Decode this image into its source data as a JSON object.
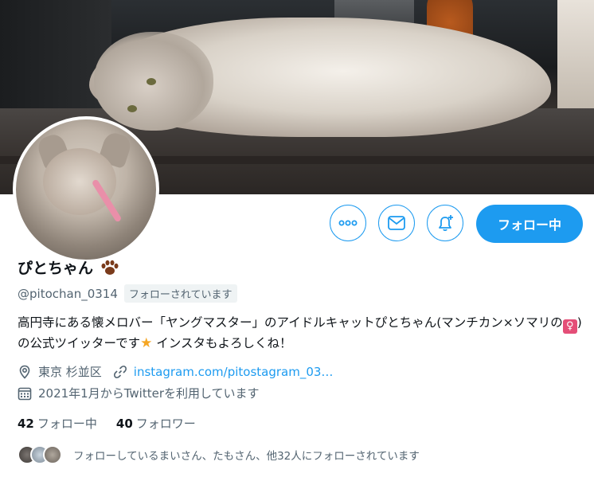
{
  "profile": {
    "name": "ぴとちゃん",
    "handle": "@pitochan_0314",
    "follows_you_badge": "フォローされています",
    "bio_part1": "高円寺にある懐メロバー「ヤングマスター」のアイドルキャットぴとちゃん(マンチカン×ソマリの",
    "bio_emoji_female": "♀",
    "bio_part2": ")の公式ツイッターです",
    "bio_emoji_star": "★",
    "bio_part3": " インスタもよろしくね！",
    "location": "東京 杉並区",
    "website": "instagram.com/pitostagram_03…",
    "joined": "2021年1月からTwitterを利用しています"
  },
  "counts": {
    "following_num": "42",
    "following_label": "フォロー中",
    "followers_num": "40",
    "followers_label": "フォロワー"
  },
  "known_followers": {
    "text": "フォローしているまいさん、たもさん、他32人にフォローされています"
  },
  "actions": {
    "follow_label": "フォロー中",
    "more_icon": "more-icon",
    "message_icon": "envelope-icon",
    "notify_icon": "bell-plus-icon"
  },
  "colors": {
    "accent": "#1d9bf0",
    "text_primary": "#0f1419",
    "text_secondary": "#536471"
  }
}
